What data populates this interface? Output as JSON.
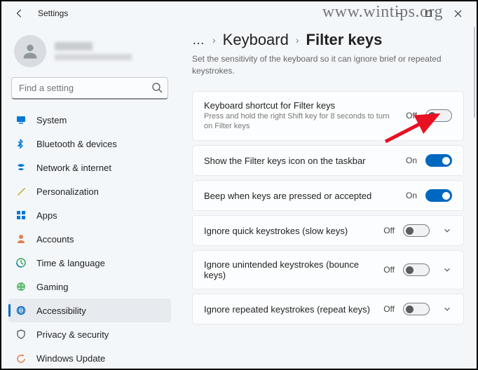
{
  "window": {
    "title": "Settings"
  },
  "watermark": "www.wintips.org",
  "search": {
    "placeholder": "Find a setting"
  },
  "sidebar": {
    "items": [
      {
        "label": "System"
      },
      {
        "label": "Bluetooth & devices"
      },
      {
        "label": "Network & internet"
      },
      {
        "label": "Personalization"
      },
      {
        "label": "Apps"
      },
      {
        "label": "Accounts"
      },
      {
        "label": "Time & language"
      },
      {
        "label": "Gaming"
      },
      {
        "label": "Accessibility"
      },
      {
        "label": "Privacy & security"
      },
      {
        "label": "Windows Update"
      }
    ]
  },
  "breadcrumb": {
    "dots": "…",
    "parent": "Keyboard",
    "current": "Filter keys"
  },
  "description": "Set the sensitivity of the keyboard so it can ignore brief or repeated keystrokes.",
  "cards": [
    {
      "label": "Keyboard shortcut for Filter keys",
      "sub": "Press and hold the right Shift key for 8 seconds to turn on Filter keys",
      "state": "Off",
      "on": false,
      "expand": false
    },
    {
      "label": "Show the Filter keys icon on the taskbar",
      "sub": "",
      "state": "On",
      "on": true,
      "expand": false
    },
    {
      "label": "Beep when keys are pressed or accepted",
      "sub": "",
      "state": "On",
      "on": true,
      "expand": false
    },
    {
      "label": "Ignore quick keystrokes (slow keys)",
      "sub": "",
      "state": "Off",
      "on": false,
      "expand": true
    },
    {
      "label": "Ignore unintended keystrokes (bounce keys)",
      "sub": "",
      "state": "Off",
      "on": false,
      "expand": true
    },
    {
      "label": "Ignore repeated keystrokes (repeat keys)",
      "sub": "",
      "state": "Off",
      "on": false,
      "expand": true
    }
  ]
}
